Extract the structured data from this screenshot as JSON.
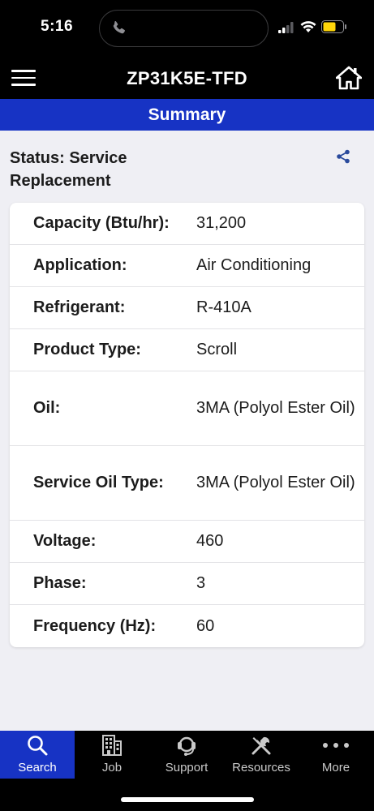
{
  "status_bar": {
    "time": "5:16",
    "icons": [
      "call-icon",
      "signal-icon",
      "wifi-icon",
      "battery-icon"
    ],
    "battery_color": "#ffd60a"
  },
  "header": {
    "title": "ZP31K5E-TFD",
    "left_icon": "menu-icon",
    "right_icon": "home-icon"
  },
  "summary": {
    "title": "Summary",
    "status": "Status: Service Replacement",
    "share_icon": "share-icon"
  },
  "specs": [
    {
      "label": "Capacity (Btu/hr):",
      "value": "31,200"
    },
    {
      "label": "Application:",
      "value": "Air Conditioning"
    },
    {
      "label": "Refrigerant:",
      "value": "R-410A"
    },
    {
      "label": "Product Type:",
      "value": "Scroll"
    },
    {
      "label": "Oil:",
      "value": "3MA (Polyol Ester Oil)"
    },
    {
      "label": "Service Oil Type:",
      "value": "3MA (Polyol Ester Oil)"
    },
    {
      "label": "Voltage:",
      "value": "460"
    },
    {
      "label": "Phase:",
      "value": "3"
    },
    {
      "label": "Frequency (Hz):",
      "value": "60"
    }
  ],
  "tabs": [
    {
      "label": "Search",
      "icon": "search-icon",
      "active": true
    },
    {
      "label": "Job",
      "icon": "building-icon",
      "active": false
    },
    {
      "label": "Support",
      "icon": "headset-icon",
      "active": false
    },
    {
      "label": "Resources",
      "icon": "tools-icon",
      "active": false
    },
    {
      "label": "More",
      "icon": "more-icon",
      "active": false
    }
  ],
  "colors": {
    "accent": "#1733c4",
    "background": "#efeff4",
    "header": "#000000"
  }
}
